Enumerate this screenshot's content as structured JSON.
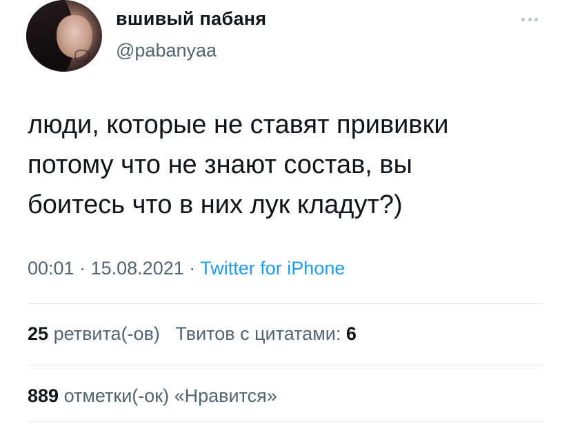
{
  "user": {
    "display_name": "вшивый пабаня",
    "handle": "@pabanyaa"
  },
  "tweet": {
    "lines": [
      "люди, которые не ставят прививки",
      "потому что не знают состав, вы",
      "боитесь что в них лук кладут?)"
    ],
    "time": "00:01",
    "separator": "·",
    "date": "15.08.2021",
    "source": "Twitter for iPhone"
  },
  "stats": {
    "retweets_count": "25",
    "retweets_label": "ретвита(-ов)",
    "quotes_label": "Твитов с цитатами:",
    "quotes_count": "6",
    "likes_count": "889",
    "likes_label": "отметки(-ок) «Нравится»"
  },
  "colors": {
    "text": "#0f1419",
    "secondary": "#536471",
    "link": "#1d9bf0"
  },
  "icons": {
    "more": "more-horizontal-icon"
  }
}
